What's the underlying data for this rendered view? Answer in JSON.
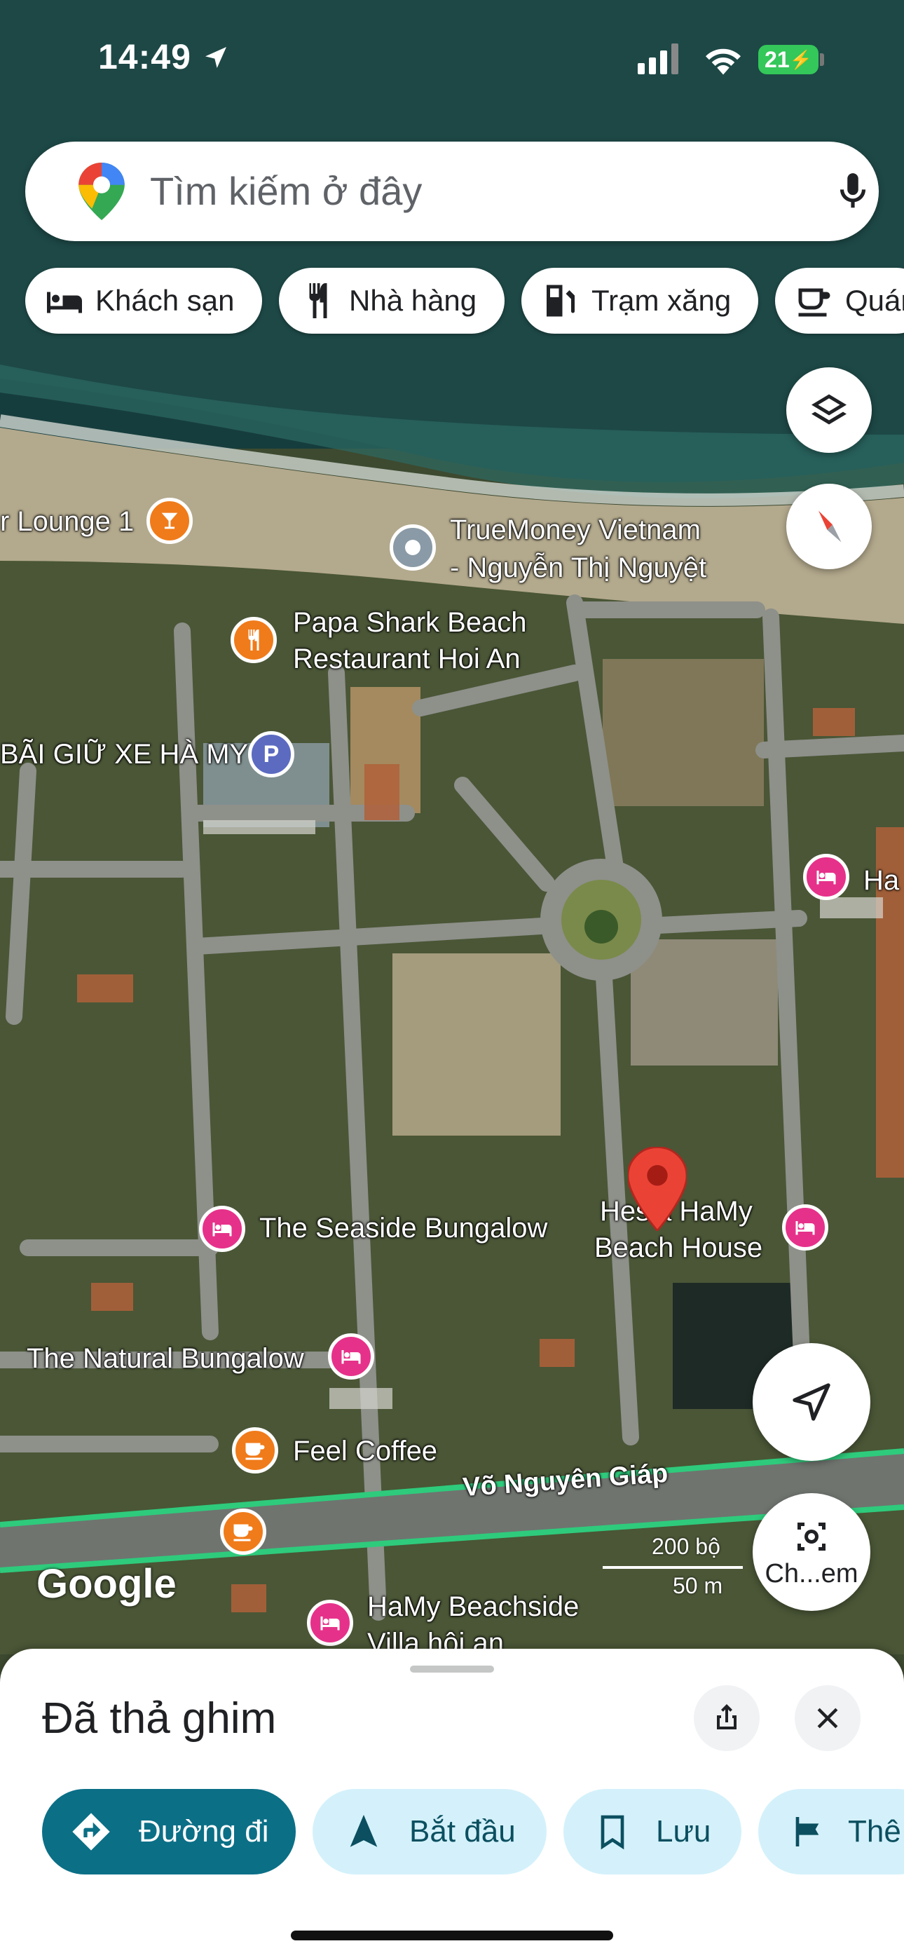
{
  "status_bar": {
    "time": "14:49",
    "battery": "21"
  },
  "search": {
    "placeholder": "Tìm kiếm ở đây"
  },
  "chips": [
    {
      "label": "Khách sạn",
      "icon": "bed-icon"
    },
    {
      "label": "Nhà hàng",
      "icon": "restaurant-icon"
    },
    {
      "label": "Trạm xăng",
      "icon": "gas-station-icon"
    },
    {
      "label": "Quán",
      "icon": "cafe-icon"
    }
  ],
  "map_labels": {
    "lounge": "r Lounge 1",
    "truemoney_1": "TrueMoney Vietnam",
    "truemoney_2": "- Nguyễn Thị Nguyệt",
    "papa_1": "Papa Shark Beach",
    "papa_2": "Restaurant Hoi An",
    "parking": "BÃI GIỮ XE HÀ MY",
    "ha": "Ha",
    "seaside": "The Seaside Bungalow",
    "hesla_1": "Hesla HaMy",
    "hesla_2": "Beach House",
    "natural": "The Natural Bungalow",
    "feel": "Feel Coffee",
    "road": "Võ Nguyên Giáp",
    "hamy_1": "HaMy Beachside",
    "hamy_2": "Villa hội an",
    "google": "Google",
    "scale_ft": "200 bộ",
    "scale_m": "50 m"
  },
  "lens_button": {
    "label": "Ch...em"
  },
  "sheet": {
    "title": "Đã thả ghim",
    "actions": [
      {
        "label": "Đường đi"
      },
      {
        "label": "Bắt đầu"
      },
      {
        "label": "Lưu"
      },
      {
        "label": "Thê"
      }
    ]
  },
  "colors": {
    "primary": "#0b6f86",
    "chip_light": "#d4f1fb",
    "pin_red": "#ea4335",
    "hotel_pink": "#e6318a",
    "food_orange": "#f07b1a",
    "road_green": "#2ecb7c"
  }
}
